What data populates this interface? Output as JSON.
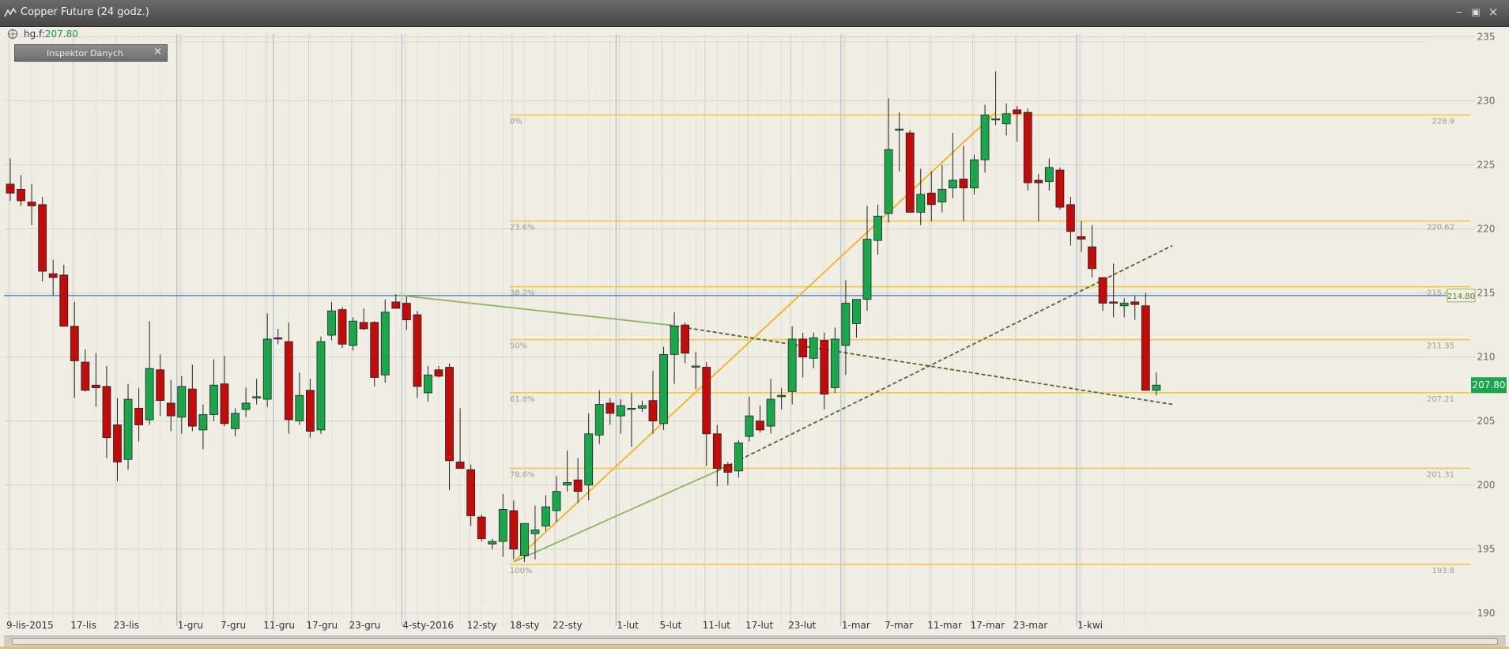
{
  "window": {
    "title": "Copper Future (24 godz.)",
    "minimize": "‒",
    "restore": "▣",
    "close": "×"
  },
  "symbol": {
    "label": "hg.f:",
    "price": "207.80"
  },
  "inspector": {
    "label": "Inspektor Danych",
    "close": "×"
  },
  "colors": {
    "up": "#1aa64a",
    "down": "#c20c0c",
    "fib": "#f2c94c",
    "trend_orange": "#f5b21b",
    "trend_green": "#8fb45a",
    "hline": "#5b86c5",
    "price_badge": "#1aa64a"
  },
  "chart_data": {
    "type": "candlestick",
    "ylim": [
      188.8,
      235.5
    ],
    "yticks": [
      190,
      195,
      200,
      205,
      210,
      215,
      220,
      225,
      230,
      235
    ],
    "x_labels": [
      {
        "i": 0,
        "label": "9-lis-2015"
      },
      {
        "i": 6,
        "label": "17-lis"
      },
      {
        "i": 10,
        "label": "23-lis"
      },
      {
        "i": 16,
        "label": "1-gru"
      },
      {
        "i": 20,
        "label": "7-gru"
      },
      {
        "i": 24,
        "label": "11-gru"
      },
      {
        "i": 28,
        "label": "17-gru"
      },
      {
        "i": 32,
        "label": "23-gru"
      },
      {
        "i": 37,
        "label": "4-sty-2016"
      },
      {
        "i": 43,
        "label": "12-sty"
      },
      {
        "i": 47,
        "label": "18-sty"
      },
      {
        "i": 51,
        "label": "22-sty"
      },
      {
        "i": 57,
        "label": "1-lut"
      },
      {
        "i": 61,
        "label": "5-lut"
      },
      {
        "i": 65,
        "label": "11-lut"
      },
      {
        "i": 69,
        "label": "17-lut"
      },
      {
        "i": 73,
        "label": "23-lut"
      },
      {
        "i": 78,
        "label": "1-mar"
      },
      {
        "i": 82,
        "label": "7-mar"
      },
      {
        "i": 86,
        "label": "11-mar"
      },
      {
        "i": 90,
        "label": "17-mar"
      },
      {
        "i": 94,
        "label": "23-mar"
      },
      {
        "i": 100,
        "label": "1-kwi"
      }
    ],
    "vlines": [
      16,
      25,
      37,
      57,
      78,
      100
    ],
    "candles": [
      [
        223.5,
        225.5,
        222.2,
        222.8
      ],
      [
        223.1,
        224.2,
        221.8,
        222.2
      ],
      [
        222.1,
        223.5,
        220.3,
        221.8
      ],
      [
        221.9,
        222.5,
        215.9,
        216.7
      ],
      [
        216.5,
        217.6,
        214.8,
        216.2
      ],
      [
        216.4,
        217.2,
        212.4,
        212.4
      ],
      [
        212.4,
        214.3,
        206.8,
        209.7
      ],
      [
        209.6,
        210.6,
        207.3,
        207.4
      ],
      [
        207.8,
        210.3,
        206.1,
        207.6
      ],
      [
        207.7,
        209.3,
        202.1,
        203.7
      ],
      [
        204.7,
        206.8,
        200.3,
        201.8
      ],
      [
        202.0,
        207.9,
        201.2,
        206.7
      ],
      [
        206.0,
        207.6,
        203.4,
        204.7
      ],
      [
        205.1,
        212.8,
        204.7,
        209.1
      ],
      [
        209.0,
        210.2,
        205.4,
        206.6
      ],
      [
        206.4,
        208.2,
        204.2,
        205.4
      ],
      [
        205.3,
        208.5,
        204.0,
        207.7
      ],
      [
        207.5,
        209.4,
        204.2,
        204.6
      ],
      [
        204.3,
        206.3,
        202.8,
        205.5
      ],
      [
        205.5,
        209.8,
        205.0,
        207.8
      ],
      [
        207.9,
        210.1,
        204.6,
        204.8
      ],
      [
        204.4,
        206.0,
        203.8,
        205.6
      ],
      [
        205.9,
        207.6,
        205.3,
        206.4
      ],
      [
        206.8,
        208.3,
        206.3,
        206.9
      ],
      [
        206.7,
        213.4,
        206.1,
        211.4
      ],
      [
        211.5,
        212.2,
        211.0,
        211.4
      ],
      [
        211.2,
        212.7,
        204.0,
        205.1
      ],
      [
        205.0,
        208.8,
        204.7,
        207.0
      ],
      [
        207.4,
        208.3,
        203.7,
        204.2
      ],
      [
        204.3,
        211.6,
        204.0,
        211.2
      ],
      [
        211.7,
        214.3,
        211.3,
        213.6
      ],
      [
        213.7,
        213.9,
        210.7,
        211.0
      ],
      [
        210.9,
        213.1,
        210.5,
        212.8
      ],
      [
        212.7,
        213.8,
        212.1,
        212.2
      ],
      [
        212.7,
        212.8,
        207.7,
        208.4
      ],
      [
        208.6,
        214.5,
        208.0,
        213.5
      ],
      [
        214.3,
        214.9,
        214.0,
        213.8
      ],
      [
        214.2,
        214.7,
        212.1,
        212.9
      ],
      [
        213.3,
        213.6,
        206.8,
        207.7
      ],
      [
        207.2,
        209.3,
        206.5,
        208.6
      ],
      [
        209.0,
        209.3,
        208.4,
        208.5
      ],
      [
        209.2,
        209.5,
        199.6,
        201.9
      ],
      [
        201.8,
        206.0,
        201.6,
        201.3
      ],
      [
        201.2,
        201.6,
        196.8,
        197.6
      ],
      [
        197.5,
        197.7,
        195.6,
        195.8
      ],
      [
        195.4,
        195.8,
        195.0,
        195.6
      ],
      [
        195.6,
        199.3,
        194.4,
        198.1
      ],
      [
        198.0,
        198.8,
        194.2,
        195.0
      ],
      [
        194.5,
        196.6,
        194.0,
        197.0
      ],
      [
        196.2,
        198.4,
        194.2,
        196.5
      ],
      [
        196.8,
        199.2,
        196.4,
        198.3
      ],
      [
        198.0,
        200.7,
        197.1,
        199.5
      ],
      [
        200.0,
        202.7,
        199.5,
        200.2
      ],
      [
        200.4,
        202.1,
        198.6,
        199.5
      ],
      [
        200.0,
        205.6,
        198.8,
        204.0
      ],
      [
        203.9,
        207.4,
        203.2,
        206.3
      ],
      [
        206.4,
        206.8,
        204.7,
        205.6
      ],
      [
        205.4,
        206.7,
        204.0,
        206.2
      ],
      [
        206.0,
        207.2,
        203.0,
        206.0
      ],
      [
        206.0,
        206.6,
        205.7,
        206.2
      ],
      [
        206.6,
        208.9,
        204.0,
        205.0
      ],
      [
        204.8,
        210.8,
        204.3,
        210.2
      ],
      [
        210.2,
        213.5,
        207.9,
        212.4
      ],
      [
        212.5,
        212.7,
        209.5,
        210.3
      ],
      [
        209.2,
        210.4,
        207.5,
        209.3
      ],
      [
        209.2,
        209.6,
        201.5,
        204.0
      ],
      [
        204.0,
        204.7,
        199.9,
        201.3
      ],
      [
        201.6,
        201.8,
        200.0,
        201.0
      ],
      [
        201.1,
        203.5,
        200.6,
        203.3
      ],
      [
        203.8,
        206.9,
        203.4,
        205.4
      ],
      [
        205.0,
        206.2,
        204.1,
        204.3
      ],
      [
        204.6,
        208.3,
        204.0,
        206.7
      ],
      [
        206.9,
        207.6,
        205.9,
        207.0
      ],
      [
        207.3,
        212.4,
        206.3,
        211.4
      ],
      [
        211.4,
        211.9,
        208.4,
        210.0
      ],
      [
        209.9,
        211.9,
        209.1,
        211.5
      ],
      [
        211.3,
        211.9,
        205.9,
        207.1
      ],
      [
        207.6,
        212.3,
        207.2,
        211.4
      ],
      [
        210.9,
        216.0,
        208.6,
        214.2
      ],
      [
        212.6,
        214.3,
        211.5,
        214.5
      ],
      [
        214.5,
        221.8,
        213.6,
        219.2
      ],
      [
        219.1,
        221.9,
        218.0,
        221.0
      ],
      [
        221.2,
        230.2,
        220.5,
        226.2
      ],
      [
        227.7,
        229.1,
        224.5,
        227.8
      ],
      [
        227.5,
        227.7,
        222.7,
        221.3
      ],
      [
        221.3,
        224.7,
        220.3,
        222.7
      ],
      [
        222.8,
        224.5,
        220.6,
        221.9
      ],
      [
        222.1,
        225.0,
        221.3,
        223.1
      ],
      [
        223.2,
        227.5,
        222.4,
        223.8
      ],
      [
        223.9,
        226.5,
        220.6,
        223.2
      ],
      [
        223.2,
        225.8,
        222.7,
        225.4
      ],
      [
        225.4,
        229.7,
        224.4,
        228.9
      ],
      [
        228.6,
        232.3,
        228.1,
        228.6
      ],
      [
        228.2,
        229.8,
        227.3,
        229.0
      ],
      [
        229.3,
        229.6,
        226.8,
        229.0
      ],
      [
        229.1,
        229.4,
        223.0,
        223.6
      ],
      [
        223.8,
        224.3,
        220.6,
        223.6
      ],
      [
        223.7,
        225.5,
        223.0,
        224.8
      ],
      [
        224.6,
        224.8,
        221.5,
        221.7
      ],
      [
        221.9,
        222.5,
        218.7,
        219.8
      ],
      [
        219.4,
        220.6,
        218.2,
        219.2
      ],
      [
        218.6,
        220.3,
        216.2,
        216.9
      ],
      [
        216.2,
        216.2,
        213.6,
        214.2
      ],
      [
        214.3,
        217.3,
        213.1,
        214.2
      ],
      [
        214.0,
        214.6,
        213.1,
        214.2
      ],
      [
        214.3,
        214.8,
        212.9,
        214.1
      ],
      [
        214.0,
        215.0,
        207.5,
        207.4
      ],
      [
        207.4,
        208.8,
        207.0,
        207.8
      ]
    ],
    "fib": [
      {
        "pct": "0%",
        "value": 228.9,
        "label": "228.9"
      },
      {
        "pct": "23.6%",
        "value": 220.62,
        "label": "220.62"
      },
      {
        "pct": "38.2%",
        "value": 215.49,
        "label": "215.49"
      },
      {
        "pct": "50%",
        "value": 211.35,
        "label": "211.35"
      },
      {
        "pct": "61.8%",
        "value": 207.21,
        "label": "207.21"
      },
      {
        "pct": "78.6%",
        "value": 201.31,
        "label": "201.31"
      },
      {
        "pct": "100%",
        "value": 193.8,
        "label": "193.8"
      }
    ],
    "fib_start_i": 47,
    "hline": {
      "value": 214.8,
      "label": "214.80"
    },
    "current_price": {
      "value": 207.8,
      "label": "207.80"
    },
    "trendlines": [
      {
        "kind": "orange",
        "from": [
          47,
          194.0
        ],
        "to": [
          92,
          229.1
        ]
      },
      {
        "kind": "green-solid",
        "from": [
          47,
          194.0
        ],
        "to": [
          66,
          201.1
        ]
      },
      {
        "kind": "green-dashed",
        "from": [
          66,
          201.1
        ],
        "to": [
          108.5,
          218.7
        ]
      },
      {
        "kind": "green-solid",
        "from": [
          36.5,
          214.8
        ],
        "to": [
          61.5,
          212.5
        ]
      },
      {
        "kind": "green-dashed",
        "from": [
          61.5,
          212.5
        ],
        "to": [
          108.5,
          206.3
        ]
      }
    ]
  }
}
